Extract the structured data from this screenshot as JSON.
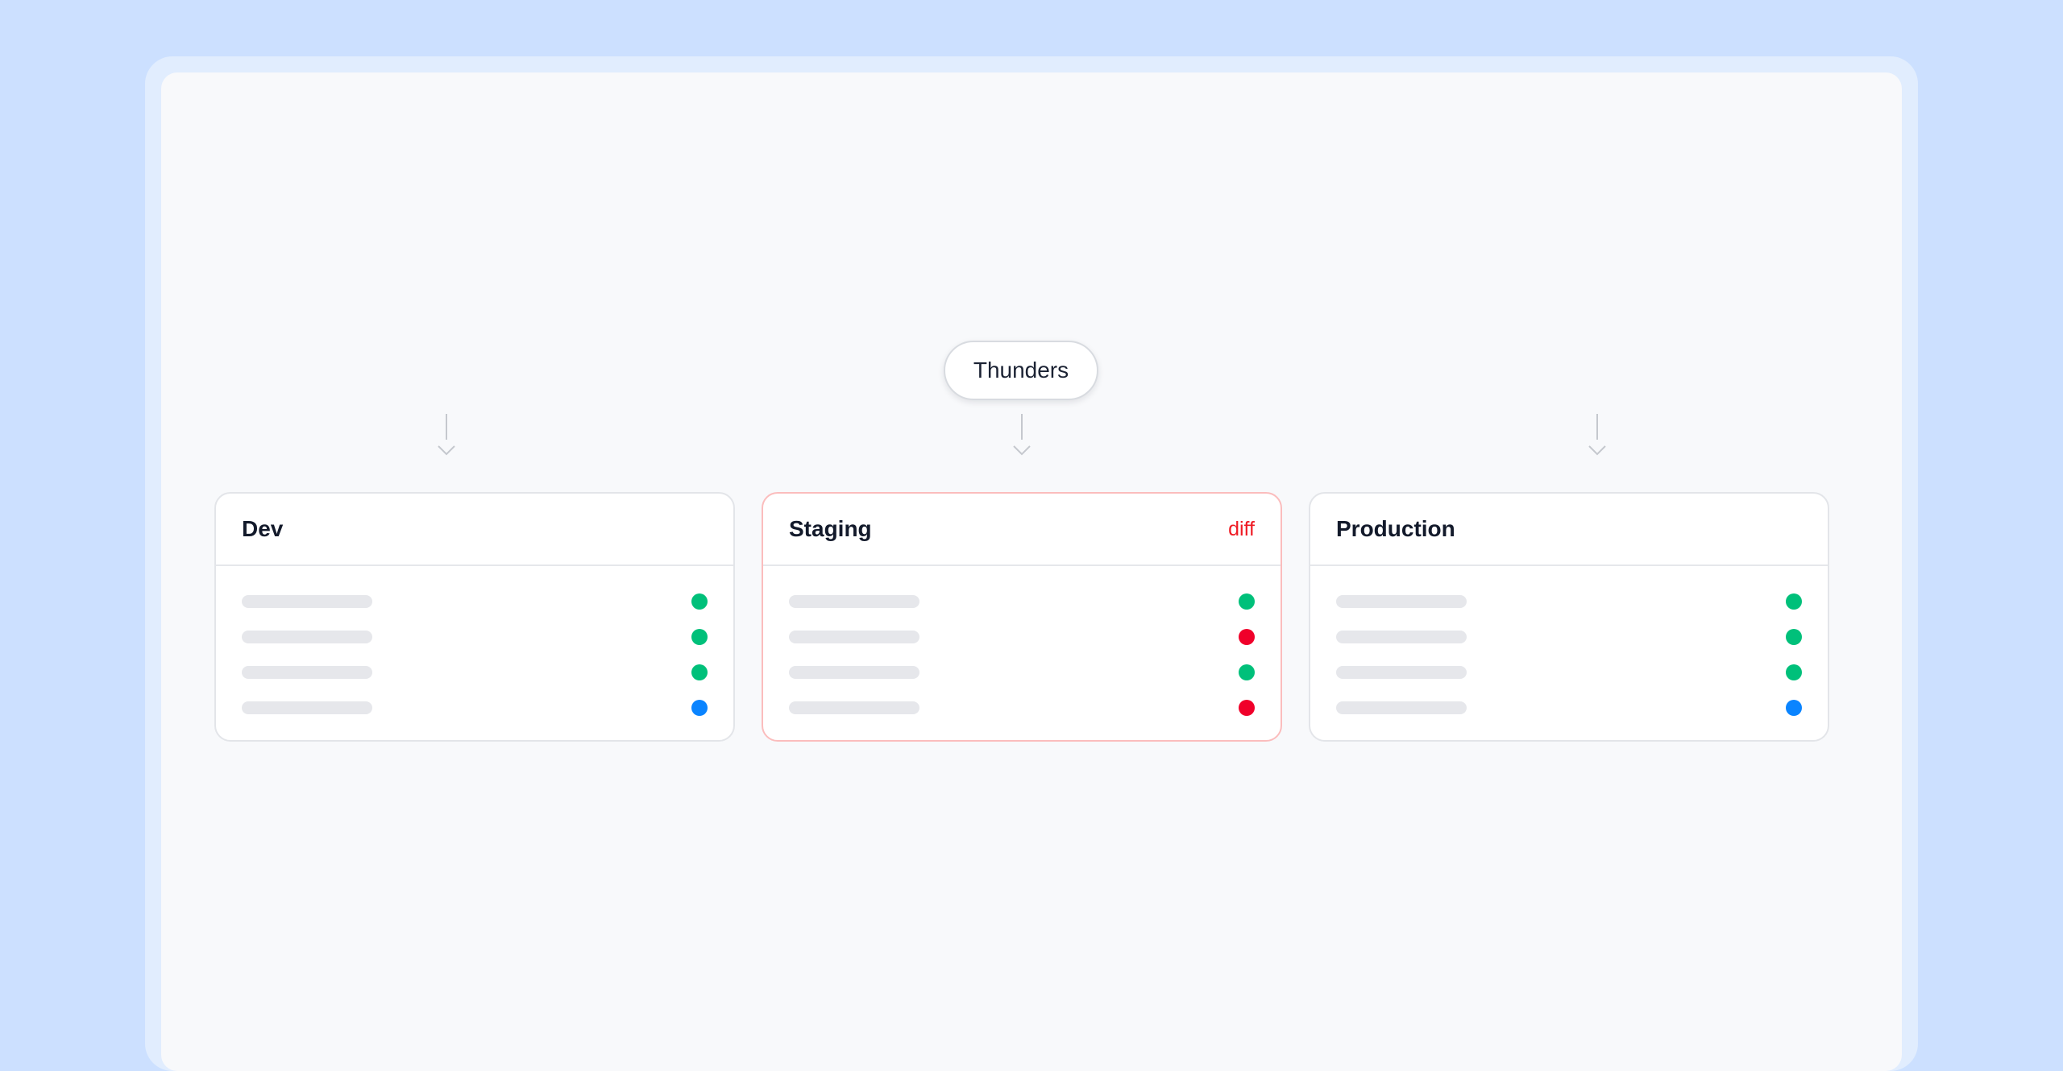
{
  "source": {
    "label": "Thunders"
  },
  "colors": {
    "ok": "#00c07a",
    "error": "#f0002a",
    "info": "#0a84ff",
    "diff": "#ef1b24"
  },
  "environments": [
    {
      "name": "Dev",
      "badge": "",
      "has_diff": false,
      "rows": [
        {
          "status": "ok"
        },
        {
          "status": "ok"
        },
        {
          "status": "ok"
        },
        {
          "status": "info"
        }
      ]
    },
    {
      "name": "Staging",
      "badge": "diff",
      "has_diff": true,
      "rows": [
        {
          "status": "ok"
        },
        {
          "status": "error"
        },
        {
          "status": "ok"
        },
        {
          "status": "error"
        }
      ]
    },
    {
      "name": "Production",
      "badge": "",
      "has_diff": false,
      "rows": [
        {
          "status": "ok"
        },
        {
          "status": "ok"
        },
        {
          "status": "ok"
        },
        {
          "status": "info"
        }
      ]
    }
  ]
}
